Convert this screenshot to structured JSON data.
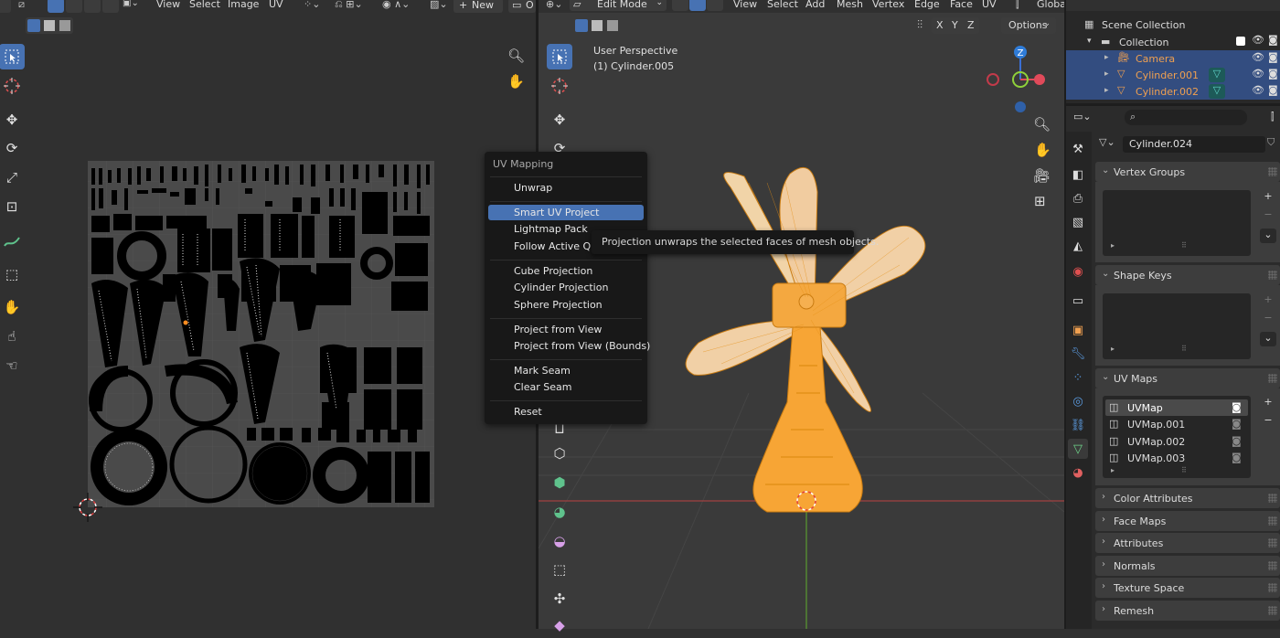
{
  "uv_editor": {
    "header_menus": [
      "View",
      "Select",
      "Image",
      "UV"
    ],
    "new_button": "New",
    "truncated_label": "O"
  },
  "viewport": {
    "mode": "Edit Mode",
    "header_menus": [
      "View",
      "Select",
      "Add",
      "Mesh",
      "Vertex",
      "Edge",
      "Face",
      "UV"
    ],
    "orientation_label": "Globa",
    "axes": [
      "X",
      "Y",
      "Z"
    ],
    "options_label": "Options",
    "overlay_title": "User Perspective",
    "overlay_object": "(1) Cylinder.005",
    "gizmo_z": "Z"
  },
  "uv_menu": {
    "title": "UV Mapping",
    "items": [
      "Unwrap",
      "Smart UV Project",
      "Lightmap Pack",
      "Follow Active Quads",
      "Cube Projection",
      "Cylinder Projection",
      "Sphere Projection",
      "Project from View",
      "Project from View (Bounds)",
      "Mark Seam",
      "Clear Seam",
      "Reset"
    ],
    "highlighted": "Smart UV Project",
    "tooltip": "Projection unwraps the selected faces of mesh objects."
  },
  "outliner": {
    "scene_collection": "Scene Collection",
    "collection": "Collection",
    "objects": [
      "Camera",
      "Cylinder.001",
      "Cylinder.002"
    ]
  },
  "properties": {
    "data_name": "Cylinder.024",
    "panels": {
      "vertex_groups": "Vertex Groups",
      "shape_keys": "Shape Keys",
      "uv_maps": "UV Maps",
      "color_attributes": "Color Attributes",
      "face_maps": "Face Maps",
      "attributes": "Attributes",
      "normals": "Normals",
      "texture_space": "Texture Space",
      "remesh": "Remesh"
    },
    "uv_maps": [
      "UVMap",
      "UVMap.001",
      "UVMap.002",
      "UVMap.003"
    ]
  },
  "colors": {
    "accent": "#4772b3",
    "selection": "#ffa033",
    "object_label": "#f0a050",
    "background": "#303030",
    "menu": "#181818"
  }
}
